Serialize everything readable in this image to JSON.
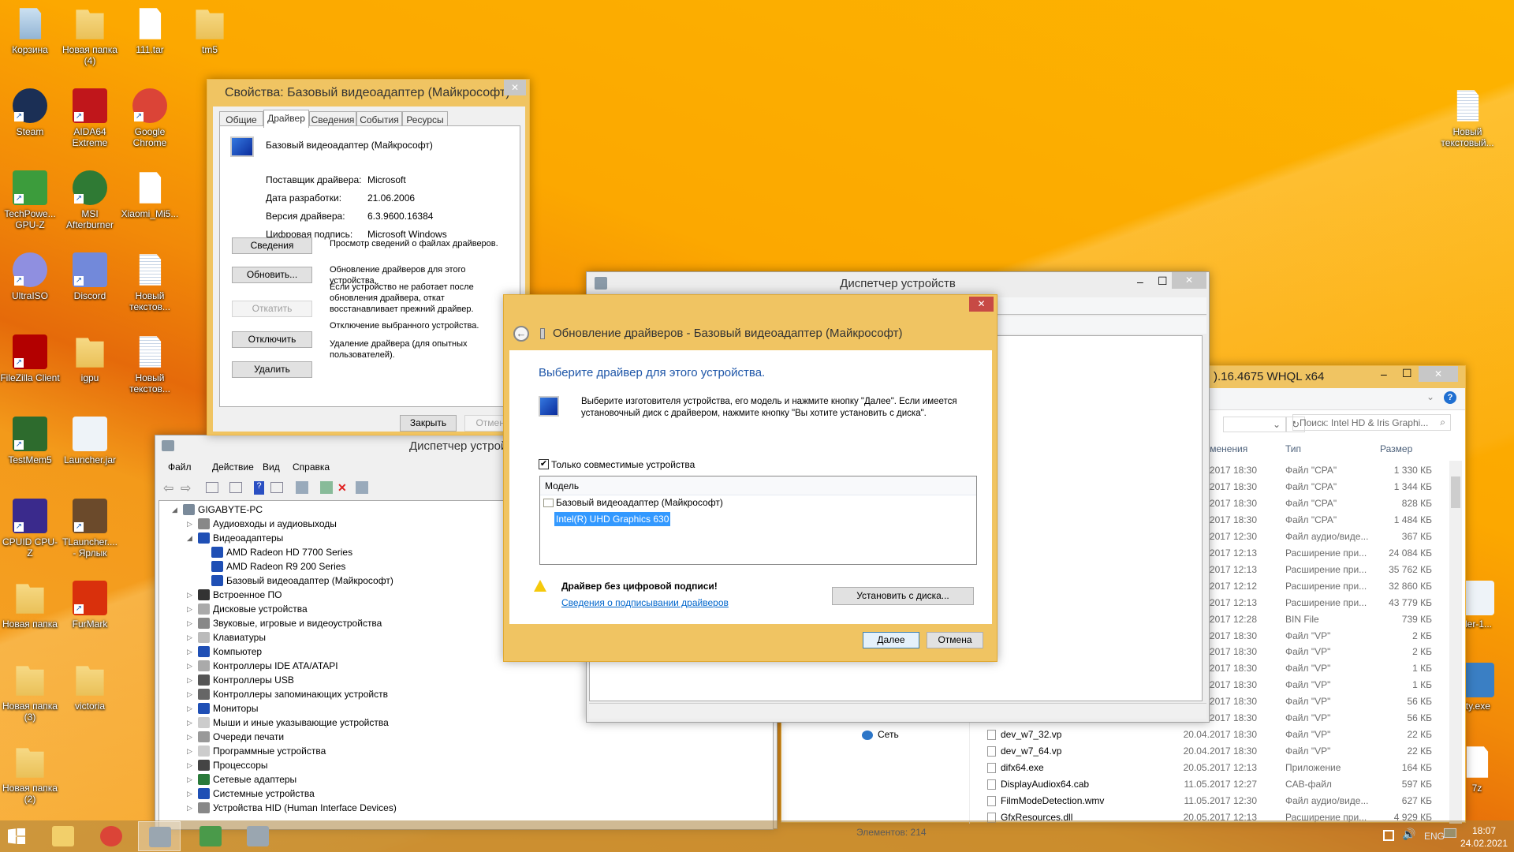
{
  "desktop": {
    "icons": [
      {
        "label": "Корзина",
        "icon": "recycle-bin-icon",
        "col": 0,
        "row": 0,
        "kind": "bin"
      },
      {
        "label": "Новая папка (4)",
        "icon": "folder-icon",
        "col": 1,
        "row": 0,
        "kind": "folder"
      },
      {
        "label": "111.tar",
        "icon": "file-icon",
        "col": 2,
        "row": 0,
        "kind": "file"
      },
      {
        "label": "tm5",
        "icon": "folder-icon",
        "col": 3,
        "row": 0,
        "kind": "folder"
      },
      {
        "label": "Steam",
        "icon": "steam-icon",
        "col": 0,
        "row": 1,
        "kind": "app",
        "color": "#1b2f55",
        "round": true,
        "sc": true
      },
      {
        "label": "AIDA64 Extreme",
        "icon": "aida64-icon",
        "col": 1,
        "row": 1,
        "kind": "app",
        "color": "#c0161b",
        "sc": true
      },
      {
        "label": "Google Chrome",
        "icon": "chrome-icon",
        "col": 2,
        "row": 1,
        "kind": "app",
        "color": "#db4437",
        "round": true,
        "sc": true
      },
      {
        "label": "TechPowe... GPU-Z",
        "icon": "gpuz-icon",
        "col": 0,
        "row": 2,
        "kind": "app",
        "color": "#3c9c3c",
        "sc": true
      },
      {
        "label": "MSI Afterburner",
        "icon": "msi-afterburner-icon",
        "col": 1,
        "row": 2,
        "kind": "app",
        "color": "#2f7a34",
        "round": true,
        "sc": true
      },
      {
        "label": "Xiaomi_Mi5...",
        "icon": "file-icon",
        "col": 2,
        "row": 2,
        "kind": "file"
      },
      {
        "label": "UltraISO",
        "icon": "ultraiso-icon",
        "col": 0,
        "row": 3,
        "kind": "app",
        "color": "#8f8fe0",
        "round": true,
        "sc": true
      },
      {
        "label": "Discord",
        "icon": "discord-icon",
        "col": 1,
        "row": 3,
        "kind": "app",
        "color": "#7289da",
        "sc": true
      },
      {
        "label": "Новый текстов...",
        "icon": "text-file-icon",
        "col": 2,
        "row": 3,
        "kind": "text"
      },
      {
        "label": "FileZilla Client",
        "icon": "filezilla-icon",
        "col": 0,
        "row": 4,
        "kind": "app",
        "color": "#b30000",
        "sc": true
      },
      {
        "label": "igpu",
        "icon": "folder-icon",
        "col": 1,
        "row": 4,
        "kind": "folder"
      },
      {
        "label": "Новый текстов...",
        "icon": "text-file-icon",
        "col": 2,
        "row": 4,
        "kind": "text"
      },
      {
        "label": "TestMem5",
        "icon": "testmem-icon",
        "col": 0,
        "row": 5,
        "kind": "app",
        "color": "#2d6b2d",
        "sc": true
      },
      {
        "label": "Launcher.jar",
        "icon": "java-icon",
        "col": 1,
        "row": 5,
        "kind": "app",
        "color": "#eef3f8"
      },
      {
        "label": "CPUID CPU-Z",
        "icon": "cpuz-icon",
        "col": 0,
        "row": 6,
        "kind": "app",
        "color": "#3a2a8c",
        "sc": true
      },
      {
        "label": "TLauncher.... - Ярлык",
        "icon": "minecraft-icon",
        "col": 1,
        "row": 6,
        "kind": "app",
        "color": "#6b4a2b",
        "sc": true
      },
      {
        "label": "Новая папка",
        "icon": "folder-icon",
        "col": 0,
        "row": 7,
        "kind": "folder"
      },
      {
        "label": "FurMark",
        "icon": "furmark-icon",
        "col": 1,
        "row": 7,
        "kind": "app",
        "color": "#d9300c",
        "sc": true
      },
      {
        "label": "Новая папка (3)",
        "icon": "folder-icon",
        "col": 0,
        "row": 8,
        "kind": "folder"
      },
      {
        "label": "victoria",
        "icon": "folder-icon",
        "col": 1,
        "row": 8,
        "kind": "folder"
      },
      {
        "label": "Новая папка (2)",
        "icon": "folder-icon",
        "col": 0,
        "row": 9,
        "kind": "folder"
      }
    ],
    "right_icons": [
      {
        "label": "Новый текстовый...",
        "icon": "text-file-icon",
        "kind": "text"
      },
      {
        "label": "der-1...",
        "icon": "java-icon",
        "kind": "app",
        "color": "#eef3f8"
      },
      {
        "label": "ity.exe",
        "icon": "shield-app-icon",
        "kind": "app",
        "color": "#3a7fc4"
      },
      {
        "label": "7z",
        "icon": "file-icon",
        "kind": "file"
      }
    ]
  },
  "properties": {
    "title": "Свойства: Базовый видеоадаптер (Майкрософт)",
    "tabs": [
      "Общие",
      "Драйвер",
      "Сведения",
      "События",
      "Ресурсы"
    ],
    "active_tab": "Драйвер",
    "device_name": "Базовый видеоадаптер (Майкрософт)",
    "fields": [
      {
        "label": "Поставщик драйвера:",
        "value": "Microsoft"
      },
      {
        "label": "Дата разработки:",
        "value": "21.06.2006"
      },
      {
        "label": "Версия драйвера:",
        "value": "6.3.9600.16384"
      },
      {
        "label": "Цифровая подпись:",
        "value": "Microsoft Windows"
      }
    ],
    "actions": [
      {
        "button": "Сведения",
        "desc": "Просмотр сведений о файлах драйверов.",
        "disabled": false
      },
      {
        "button": "Обновить...",
        "desc": "Обновление драйверов для этого устройства.",
        "disabled": false
      },
      {
        "button": "Откатить",
        "desc": "Если устройство не работает после обновления драйвера, откат восстанавливает прежний драйвер.",
        "disabled": true
      },
      {
        "button": "Отключить",
        "desc": "Отключение выбранного устройства.",
        "disabled": false
      },
      {
        "button": "Удалить",
        "desc": "Удаление драйвера (для опытных пользователей).",
        "disabled": false
      }
    ],
    "close_label": "Закрыть",
    "cancel_label": "Отмена"
  },
  "devmgr_back": {
    "title": "Диспетчер устрой",
    "menu": [
      "Файл",
      "Действие",
      "Вид",
      "Справка"
    ],
    "tree": [
      {
        "label": "GIGABYTE-PC",
        "level": 0,
        "exp": "open",
        "color": "#7a8a9a"
      },
      {
        "label": "Аудиовходы и аудиовыходы",
        "level": 1,
        "exp": "closed",
        "color": "#888"
      },
      {
        "label": "Видеоадаптеры",
        "level": 1,
        "exp": "open",
        "color": "#1f4fb5"
      },
      {
        "label": "AMD Radeon HD 7700 Series",
        "level": 2,
        "exp": "",
        "color": "#1f4fb5"
      },
      {
        "label": "AMD Radeon R9 200 Series",
        "level": 2,
        "exp": "",
        "color": "#1f4fb5"
      },
      {
        "label": "Базовый видеоадаптер (Майкрософт)",
        "level": 2,
        "exp": "",
        "color": "#1f4fb5"
      },
      {
        "label": "Встроенное ПО",
        "level": 1,
        "exp": "closed",
        "color": "#333"
      },
      {
        "label": "Дисковые устройства",
        "level": 1,
        "exp": "closed",
        "color": "#aaa"
      },
      {
        "label": "Звуковые, игровые и видеоустройства",
        "level": 1,
        "exp": "closed",
        "color": "#888"
      },
      {
        "label": "Клавиатуры",
        "level": 1,
        "exp": "closed",
        "color": "#bbb"
      },
      {
        "label": "Компьютер",
        "level": 1,
        "exp": "closed",
        "color": "#1f4fb5"
      },
      {
        "label": "Контроллеры IDE ATA/ATAPI",
        "level": 1,
        "exp": "closed",
        "color": "#aaa"
      },
      {
        "label": "Контроллеры USB",
        "level": 1,
        "exp": "closed",
        "color": "#555"
      },
      {
        "label": "Контроллеры запоминающих устройств",
        "level": 1,
        "exp": "closed",
        "color": "#666"
      },
      {
        "label": "Мониторы",
        "level": 1,
        "exp": "closed",
        "color": "#1f4fb5"
      },
      {
        "label": "Мыши и иные указывающие устройства",
        "level": 1,
        "exp": "closed",
        "color": "#ccc"
      },
      {
        "label": "Очереди печати",
        "level": 1,
        "exp": "closed",
        "color": "#999"
      },
      {
        "label": "Программные устройства",
        "level": 1,
        "exp": "closed",
        "color": "#ccc"
      },
      {
        "label": "Процессоры",
        "level": 1,
        "exp": "closed",
        "color": "#444"
      },
      {
        "label": "Сетевые адаптеры",
        "level": 1,
        "exp": "closed",
        "color": "#2a7a3a"
      },
      {
        "label": "Системные устройства",
        "level": 1,
        "exp": "closed",
        "color": "#1f4fb5"
      },
      {
        "label": "Устройства HID (Human Interface Devices)",
        "level": 1,
        "exp": "closed",
        "color": "#888"
      }
    ]
  },
  "devmgr_front": {
    "title": "Диспетчер устройств"
  },
  "update_dialog": {
    "title": "Обновление драйверов - Базовый видеоадаптер (Майкрософт)",
    "heading": "Выберите драйвер для этого устройства.",
    "description": "Выберите изготовителя устройства, его модель и нажмите кнопку \"Далее\". Если имеется установочный диск с  драйвером, нажмите кнопку \"Вы хотите установить с диска\".",
    "checkbox_label": "Только совместимые устройства",
    "checkbox_checked": true,
    "list_header": "Модель",
    "list_items": [
      "Базовый видеоадаптер (Майкрософт)",
      "Intel(R) UHD Graphics 630"
    ],
    "selected_item": "Intel(R) UHD Graphics 630",
    "warning": "Драйвер без цифровой подписи!",
    "link": "Сведения о подписывании драйверов",
    "have_disk_label": "Установить с диска...",
    "next_label": "Далее",
    "cancel_label": "Отмена",
    "accent": "#1e56a8",
    "frame_color": "#f0c462"
  },
  "explorer": {
    "title": ").16.4675 WHQL x64",
    "search_placeholder": "Поиск: Intel HD & Iris Graphi...",
    "columns": {
      "date": "изменения",
      "type": "Тип",
      "size": "Размер"
    },
    "nav_item": "Сеть",
    "rows": [
      {
        "name": "",
        "date": ".2017 18:30",
        "type": "Файл \"CPA\"",
        "size": "1 330 КБ"
      },
      {
        "name": "",
        "date": ".2017 18:30",
        "type": "Файл \"CPA\"",
        "size": "1 344 КБ"
      },
      {
        "name": "",
        "date": ".2017 18:30",
        "type": "Файл \"CPA\"",
        "size": "828 КБ"
      },
      {
        "name": "",
        "date": ".2017 18:30",
        "type": "Файл \"CPA\"",
        "size": "1 484 КБ"
      },
      {
        "name": "",
        "date": ".2017 12:30",
        "type": "Файл аудио/виде...",
        "size": "367 КБ"
      },
      {
        "name": "",
        "date": ".2017 12:13",
        "type": "Расширение при...",
        "size": "24 084 КБ"
      },
      {
        "name": "",
        "date": ".2017 12:13",
        "type": "Расширение при...",
        "size": "35 762 КБ"
      },
      {
        "name": "",
        "date": ".2017 12:12",
        "type": "Расширение при...",
        "size": "32 860 КБ"
      },
      {
        "name": "",
        "date": ".2017 12:13",
        "type": "Расширение при...",
        "size": "43 779 КБ"
      },
      {
        "name": "",
        "date": ".2017 12:28",
        "type": "BIN File",
        "size": "739 КБ"
      },
      {
        "name": "",
        "date": ".2017 18:30",
        "type": "Файл \"VP\"",
        "size": "2 КБ"
      },
      {
        "name": "",
        "date": ".2017 18:30",
        "type": "Файл \"VP\"",
        "size": "2 КБ"
      },
      {
        "name": "",
        "date": ".2017 18:30",
        "type": "Файл \"VP\"",
        "size": "1 КБ"
      },
      {
        "name": "",
        "date": ".2017 18:30",
        "type": "Файл \"VP\"",
        "size": "1 КБ"
      },
      {
        "name": "",
        "date": ".2017 18:30",
        "type": "Файл \"VP\"",
        "size": "56 КБ"
      },
      {
        "name": "",
        "date": ".2017 18:30",
        "type": "Файл \"VP\"",
        "size": "56 КБ"
      },
      {
        "name": "dev_w7_32.vp",
        "date": "20.04.2017 18:30",
        "type": "Файл \"VP\"",
        "size": "22 КБ"
      },
      {
        "name": "dev_w7_64.vp",
        "date": "20.04.2017 18:30",
        "type": "Файл \"VP\"",
        "size": "22 КБ"
      },
      {
        "name": "difx64.exe",
        "date": "20.05.2017 12:13",
        "type": "Приложение",
        "size": "164 КБ"
      },
      {
        "name": "DisplayAudiox64.cab",
        "date": "11.05.2017 12:27",
        "type": "CAB-файл",
        "size": "597 КБ"
      },
      {
        "name": "FilmModeDetection.wmv",
        "date": "11.05.2017 12:30",
        "type": "Файл аудио/виде...",
        "size": "627 КБ"
      },
      {
        "name": "GfxResources.dll",
        "date": "20.05.2017 12:13",
        "type": "Расширение при...",
        "size": "4 929 КБ"
      }
    ],
    "status": "Элементов: 214"
  },
  "taskbar": {
    "apps": [
      {
        "name": "file-explorer",
        "icon": "folder-icon",
        "active": false
      },
      {
        "name": "chrome",
        "icon": "chrome-icon",
        "active": false
      },
      {
        "name": "device-manager",
        "icon": "device-manager-icon",
        "active": true
      },
      {
        "name": "gpu-tool",
        "icon": "monitor-icon",
        "active": false
      },
      {
        "name": "device-manager-2",
        "icon": "device-manager-icon",
        "active": false
      }
    ],
    "language": "ENG",
    "time": "18:07",
    "date": "24.02.2021"
  }
}
